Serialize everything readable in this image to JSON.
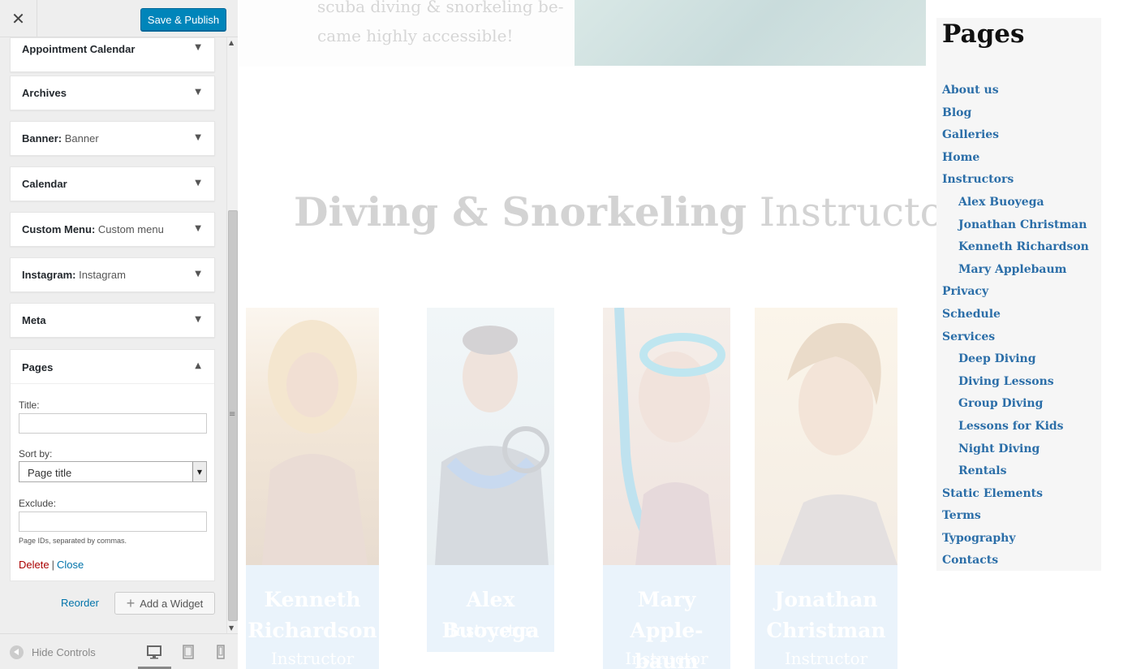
{
  "topbar": {
    "close_symbol": "✕",
    "save_label": "Save & Publish"
  },
  "widgets": [
    {
      "title": "Appointment Calendar",
      "subtitle": ""
    },
    {
      "title": "Archives",
      "subtitle": ""
    },
    {
      "title": "Banner:",
      "subtitle": "Banner"
    },
    {
      "title": "Calendar",
      "subtitle": ""
    },
    {
      "title": "Custom Menu:",
      "subtitle": "Custom menu"
    },
    {
      "title": "Instagram:",
      "subtitle": "Instagram"
    },
    {
      "title": "Meta",
      "subtitle": ""
    }
  ],
  "pages_widget": {
    "title": "Pages",
    "title_label": "Title:",
    "title_value": "",
    "sort_label": "Sort by:",
    "sort_value": "Page title",
    "exclude_label": "Exclude:",
    "exclude_value": "",
    "hint": "Page IDs, separated by commas.",
    "delete_label": "Delete",
    "separator": "|",
    "close_label": "Close"
  },
  "actions": {
    "reorder_label": "Reorder",
    "add_widget_label": "Add a Widget"
  },
  "footer": {
    "hide_controls_label": "Hide Controls",
    "active_device": "desktop"
  },
  "preview": {
    "hero_text": "scuba diving & snorkeling be-\ncame highly accessible!",
    "heading_bold": "Diving & Snorkeling",
    "heading_light": "Instructors",
    "instructors": [
      {
        "name": "Kenneth Richardson",
        "role": "Instructor"
      },
      {
        "name": "Alex Buoyega",
        "role": "Instructor"
      },
      {
        "name": "Mary Apple-baum",
        "role": "Instructor"
      },
      {
        "name": "Jonathan Christman",
        "role": "Instructor"
      }
    ]
  },
  "pages_preview": {
    "title": "Pages",
    "items": [
      {
        "label": "About us",
        "child": false
      },
      {
        "label": "Blog",
        "child": false
      },
      {
        "label": "Galleries",
        "child": false
      },
      {
        "label": "Home",
        "child": false
      },
      {
        "label": "Instructors",
        "child": false
      },
      {
        "label": "Alex Buoyega",
        "child": true
      },
      {
        "label": "Jonathan Christman",
        "child": true
      },
      {
        "label": "Kenneth Richardson",
        "child": true
      },
      {
        "label": "Mary Applebaum",
        "child": true
      },
      {
        "label": "Privacy",
        "child": false
      },
      {
        "label": "Schedule",
        "child": false
      },
      {
        "label": "Services",
        "child": false
      },
      {
        "label": "Deep Diving",
        "child": true
      },
      {
        "label": "Diving Lessons",
        "child": true
      },
      {
        "label": "Group Diving",
        "child": true
      },
      {
        "label": "Lessons for Kids",
        "child": true
      },
      {
        "label": "Night Diving",
        "child": true
      },
      {
        "label": "Rentals",
        "child": true
      },
      {
        "label": "Static Elements",
        "child": false
      },
      {
        "label": "Terms",
        "child": false
      },
      {
        "label": "Typography",
        "child": false
      },
      {
        "label": "Contacts",
        "child": false
      }
    ]
  },
  "colors": {
    "primary_button": "#0085ba",
    "link": "#0073aa",
    "delete": "#a00000",
    "page_link": "#2b6ea8"
  }
}
